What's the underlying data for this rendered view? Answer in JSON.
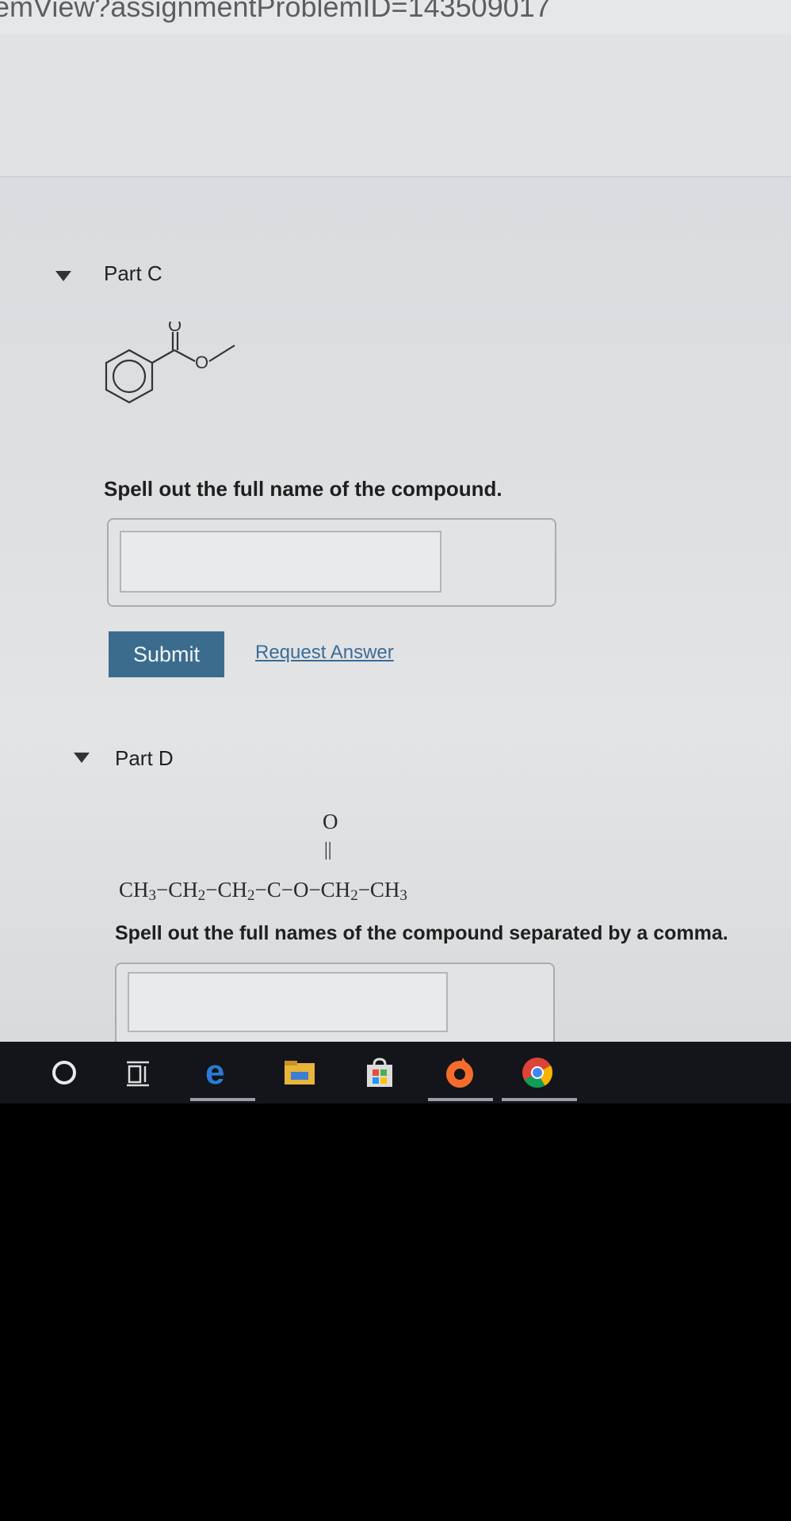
{
  "browser": {
    "url_fragment": "emView?assignmentProblemID=143509017"
  },
  "part_c": {
    "title": "Part C",
    "molecule_labels": {
      "carbonyl_o": "O",
      "ester_o": "O"
    },
    "prompt": "Spell out the full name of the compound.",
    "answer_value": "",
    "submit_label": "Submit",
    "request_answer_label": "Request Answer"
  },
  "part_d": {
    "title": "Part D",
    "carbonyl_o": "O",
    "double_bond": "||",
    "formula_segments": [
      {
        "text": "CH",
        "sub": "3"
      },
      {
        "text": "−CH",
        "sub": "2"
      },
      {
        "text": "−CH",
        "sub": "2"
      },
      {
        "text": "−C−O−CH",
        "sub": "2"
      },
      {
        "text": "−CH",
        "sub": "3"
      }
    ],
    "prompt": "Spell out the full names of the compound separated by a comma.",
    "answer_value": ""
  },
  "taskbar": {
    "icons": [
      "cortana-icon",
      "task-view-icon",
      "edge-icon",
      "file-explorer-icon",
      "store-icon",
      "origin-icon",
      "chrome-icon"
    ]
  },
  "colors": {
    "submit_bg": "#3b6c8e",
    "link": "#3a6c96",
    "taskbar": "#13151a"
  }
}
